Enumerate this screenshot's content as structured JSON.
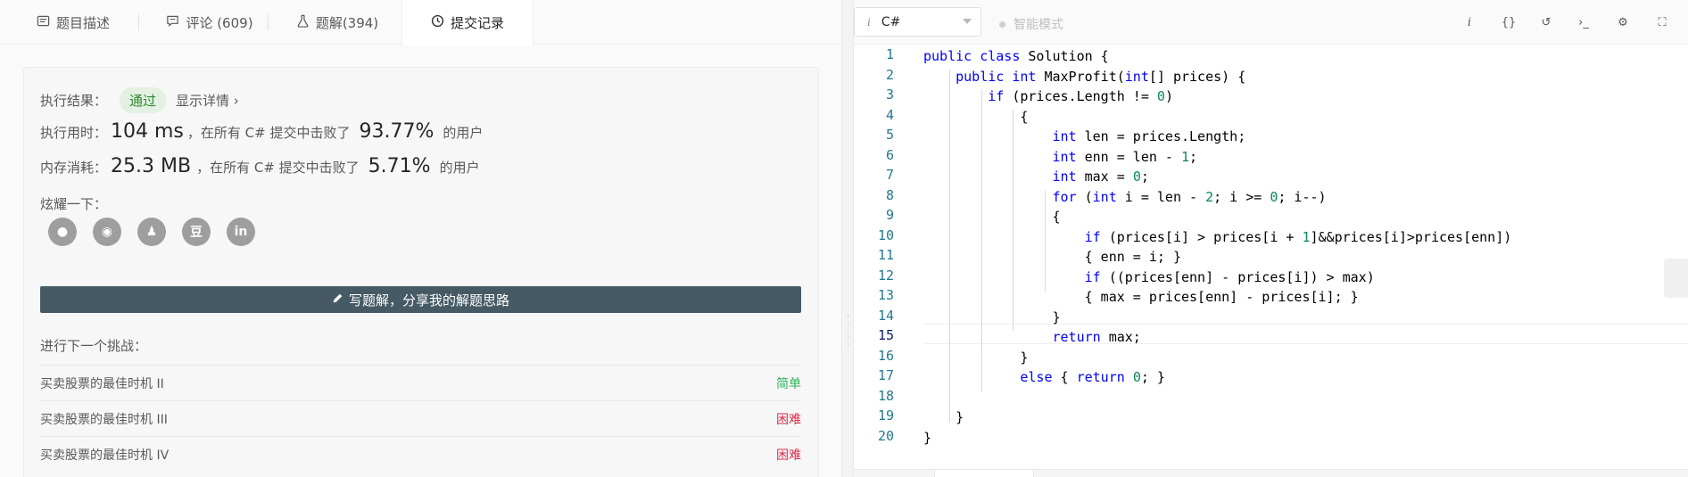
{
  "tabs": [
    {
      "label": "题目描述",
      "icon": "description-icon"
    },
    {
      "label": "评论 (609)",
      "icon": "comment-icon"
    },
    {
      "label": "题解(394)",
      "icon": "flask-icon"
    },
    {
      "label": "提交记录",
      "icon": "clock-icon"
    }
  ],
  "result": {
    "label": "执行结果：",
    "status": "通过",
    "detail_link": "显示详情 ›"
  },
  "runtime": {
    "label": "执行用时：",
    "value": "104 ms",
    "mid": "，在所有 C# 提交中击败了",
    "percent": "93.77%",
    "suffix": "的用户"
  },
  "memory": {
    "label": "内存消耗：",
    "value": "25.3 MB",
    "mid": "，在所有 C# 提交中击败了",
    "percent": "5.71%",
    "suffix": "的用户"
  },
  "share": {
    "label": "炫耀一下：",
    "icons": [
      "wechat-icon",
      "weibo-icon",
      "qq-icon",
      "douban-icon",
      "linkedin-icon"
    ],
    "icon_glyphs": [
      "●",
      "◉",
      "♟",
      "豆",
      "in"
    ]
  },
  "write_solution": "写题解，分享我的解题思路",
  "next_challenge": {
    "label": "进行下一个挑战：",
    "items": [
      {
        "title": "买卖股票的最佳时机 II",
        "difficulty": "简单"
      },
      {
        "title": "买卖股票的最佳时机 III",
        "difficulty": "困难"
      },
      {
        "title": "买卖股票的最佳时机 IV",
        "difficulty": "困难"
      }
    ]
  },
  "editor_toolbar": {
    "language": "C#",
    "smart_mode": "智能模式",
    "icons": [
      "info-icon",
      "format-braces-icon",
      "reset-icon",
      "console-icon",
      "settings-icon",
      "fullscreen-icon"
    ],
    "icon_glyphs": [
      "i",
      "{}",
      "↺",
      "›_",
      "⚙",
      "⛶"
    ]
  },
  "code": {
    "current_line": 15,
    "lines": [
      "public class Solution {",
      "    public int MaxProfit(int[] prices) {",
      "        if (prices.Length != 0)",
      "            {",
      "                int len = prices.Length;",
      "                int enn = len - 1;",
      "                int max = 0;",
      "                for (int i = len - 2; i >= 0; i--)",
      "                {",
      "                    if (prices[i] > prices[i + 1]&&prices[i]>prices[enn])",
      "                    { enn = i; }",
      "                    if ((prices[enn] - prices[i]) > max)",
      "                    { max = prices[enn] - prices[i]; }",
      "                }",
      "                return max;",
      "            }",
      "            else { return 0; }",
      "",
      "    }",
      "}"
    ]
  },
  "colors": {
    "pass_badge_bg": "#e3f1e3",
    "pass_text": "#2d8a2d",
    "easy": "#2db55d",
    "hard": "#e02c4b",
    "write_button": "#455a64",
    "keyword": "#0000ff",
    "number": "#098658",
    "line_number": "#237893"
  }
}
